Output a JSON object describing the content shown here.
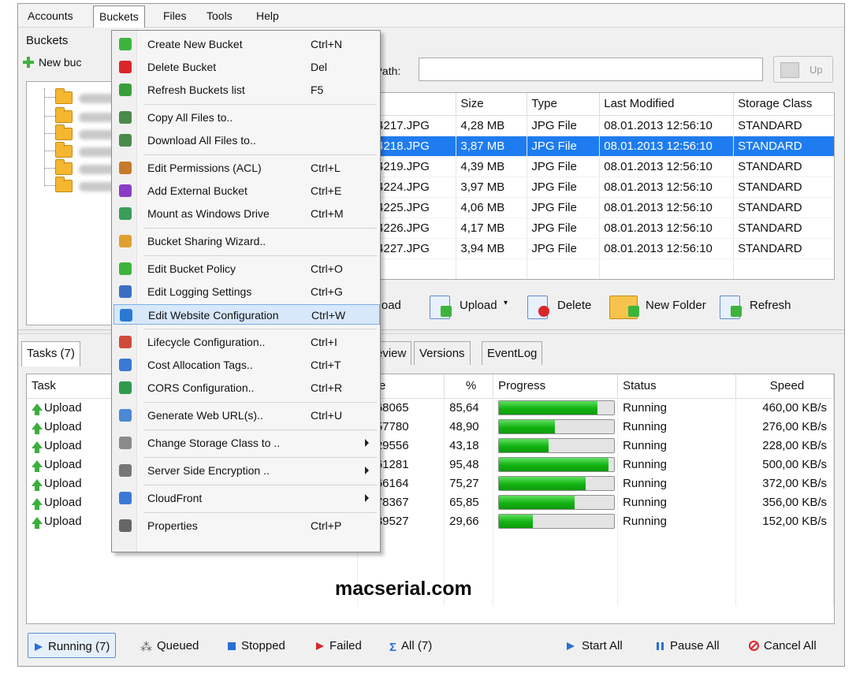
{
  "menubar": {
    "items": [
      "Accounts",
      "Buckets",
      "Files",
      "Tools",
      "Help"
    ]
  },
  "buckets_pane": {
    "title": "Buckets",
    "new_bucket_label": "New buc"
  },
  "path_bar": {
    "label": "nt Path:",
    "value": "",
    "up_label": "Up"
  },
  "files": {
    "columns": [
      "",
      "Size",
      "Type",
      "Last Modified",
      "Storage Class"
    ],
    "rows": [
      {
        "name": "C04217.JPG",
        "size": "4,28 MB",
        "type": "JPG File",
        "modified": "08.01.2013 12:56:10",
        "storage": "STANDARD"
      },
      {
        "name": "C04218.JPG",
        "size": "3,87 MB",
        "type": "JPG File",
        "modified": "08.01.2013 12:56:10",
        "storage": "STANDARD"
      },
      {
        "name": "C04219.JPG",
        "size": "4,39 MB",
        "type": "JPG File",
        "modified": "08.01.2013 12:56:10",
        "storage": "STANDARD"
      },
      {
        "name": "C04224.JPG",
        "size": "3,97 MB",
        "type": "JPG File",
        "modified": "08.01.2013 12:56:10",
        "storage": "STANDARD"
      },
      {
        "name": "C04225.JPG",
        "size": "4,06 MB",
        "type": "JPG File",
        "modified": "08.01.2013 12:56:10",
        "storage": "STANDARD"
      },
      {
        "name": "C04226.JPG",
        "size": "4,17 MB",
        "type": "JPG File",
        "modified": "08.01.2013 12:56:10",
        "storage": "STANDARD"
      },
      {
        "name": "C04227.JPG",
        "size": "3,94 MB",
        "type": "JPG File",
        "modified": "08.01.2013 12:56:10",
        "storage": "STANDARD"
      }
    ],
    "selected_index": 1
  },
  "file_toolbar": {
    "download": "ownload",
    "upload": "Upload",
    "delete": "Delete",
    "new_folder": "New Folder",
    "refresh": "Refresh"
  },
  "task_tabs": [
    "Tasks (7)",
    "Preview",
    "Versions",
    "EventLog"
  ],
  "tasks": {
    "columns": [
      "Task",
      "Size",
      "%",
      "Progress",
      "Status",
      "Speed"
    ],
    "rows": [
      {
        "task": "Upload",
        "size": "4668065",
        "percent": "85,64",
        "progress": 85.64,
        "status": "Running",
        "speed": "460,00 KB/s"
      },
      {
        "task": "Upload",
        "size": "4757780",
        "percent": "48,90",
        "progress": 48.9,
        "status": "Running",
        "speed": "276,00 KB/s"
      },
      {
        "task": "Upload",
        "size": "4629556",
        "percent": "43,18",
        "progress": 43.18,
        "status": "Running",
        "speed": "228,00 KB/s"
      },
      {
        "task": "Upload",
        "size": "4461281",
        "percent": "95,48",
        "progress": 95.48,
        "status": "Running",
        "speed": "500,00 KB/s"
      },
      {
        "task": "Upload",
        "size": "4266164",
        "percent": "75,27",
        "progress": 75.27,
        "status": "Running",
        "speed": "372,00 KB/s"
      },
      {
        "task": "Upload",
        "size": "4478367",
        "percent": "65,85",
        "progress": 65.85,
        "status": "Running",
        "speed": "356,00 KB/s"
      },
      {
        "task": "Upload",
        "size": "4639527",
        "percent": "29,66",
        "progress": 29.66,
        "status": "Running",
        "speed": "152,00 KB/s"
      }
    ]
  },
  "watermark": "macserial.com",
  "filter_bar": {
    "running": "Running (7)",
    "queued": "Queued",
    "stopped": "Stopped",
    "failed": "Failed",
    "all": "All (7)",
    "start_all": "Start All",
    "pause_all": "Pause All",
    "cancel_all": "Cancel All"
  },
  "buckets_menu": {
    "items": [
      {
        "label": "Create New Bucket",
        "shortcut": "Ctrl+N",
        "icon": "plus-icon",
        "color": "#3cb43c"
      },
      {
        "label": "Delete Bucket",
        "shortcut": "Del",
        "icon": "delete-x-icon",
        "color": "#d9262b"
      },
      {
        "label": "Refresh Buckets list",
        "shortcut": "F5",
        "icon": "refresh-icon",
        "color": "#3a9e3a"
      },
      {
        "label": "Copy All Files to..",
        "shortcut": "",
        "icon": "copy-icon",
        "color": "#4a8a4a"
      },
      {
        "label": "Download All Files to..",
        "shortcut": "",
        "icon": "download-icon",
        "color": "#4a8a4a"
      },
      {
        "label": "Edit Permissions (ACL)",
        "shortcut": "Ctrl+L",
        "icon": "users-icon",
        "color": "#c77a2a"
      },
      {
        "label": "Add External Bucket",
        "shortcut": "Ctrl+E",
        "icon": "plus-icon",
        "color": "#8a3cc4"
      },
      {
        "label": "Mount as Windows Drive",
        "shortcut": "Ctrl+M",
        "icon": "drive-icon",
        "color": "#3a9e5a"
      },
      {
        "label": "Bucket Sharing Wizard..",
        "shortcut": "",
        "icon": "wizard-icon",
        "color": "#e0a030"
      },
      {
        "label": "Edit Bucket Policy",
        "shortcut": "Ctrl+O",
        "icon": "check-icon",
        "color": "#3cb43c"
      },
      {
        "label": "Edit Logging Settings",
        "shortcut": "Ctrl+G",
        "icon": "log-icon",
        "color": "#3a6ec4"
      },
      {
        "label": "Edit Website Configuration",
        "shortcut": "Ctrl+W",
        "icon": "globe-icon",
        "color": "#2a7ad4"
      },
      {
        "label": "Lifecycle Configuration..",
        "shortcut": "Ctrl+I",
        "icon": "calendar-icon",
        "color": "#d04a3a"
      },
      {
        "label": "Cost Allocation Tags..",
        "shortcut": "Ctrl+T",
        "icon": "tag-icon",
        "color": "#3a7ad4"
      },
      {
        "label": "CORS Configuration..",
        "shortcut": "Ctrl+R",
        "icon": "cors-icon",
        "color": "#2e9a4e"
      },
      {
        "label": "Generate Web URL(s)..",
        "shortcut": "Ctrl+U",
        "icon": "url-icon",
        "color": "#4a8ad4"
      },
      {
        "label": "Change Storage Class to ..",
        "shortcut": "",
        "icon": "storage-icon",
        "color": "#8a8a8a",
        "submenu": true
      },
      {
        "label": "Server Side Encryption ..",
        "shortcut": "",
        "icon": "key-icon",
        "color": "#777777",
        "submenu": true
      },
      {
        "label": "CloudFront",
        "shortcut": "",
        "icon": "cloudfront-icon",
        "color": "#3a7ad4",
        "submenu": true
      },
      {
        "label": "Properties",
        "shortcut": "Ctrl+P",
        "icon": "properties-icon",
        "color": "#666666"
      }
    ],
    "highlighted_index": 11
  },
  "colors": {
    "selection": "#1e7cf0",
    "progress": "#12b312",
    "menu_highlight": "#d7e8fb"
  }
}
